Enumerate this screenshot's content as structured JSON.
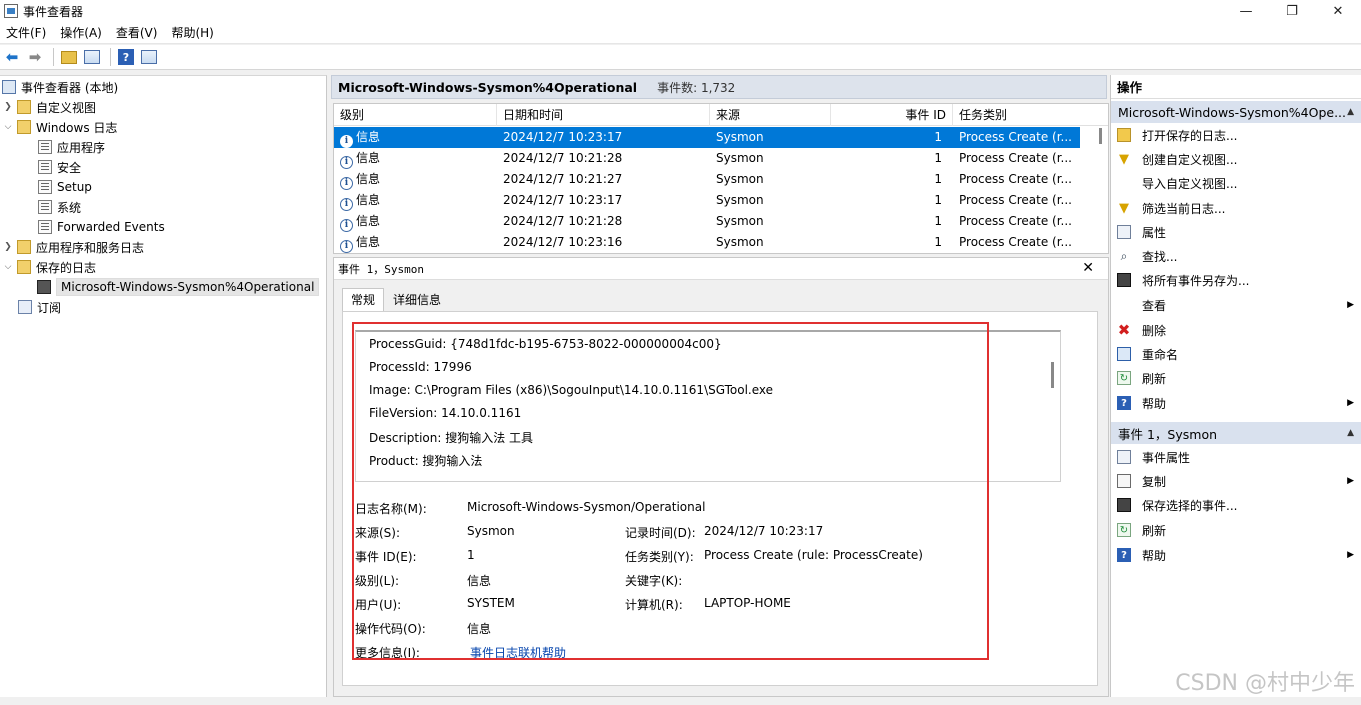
{
  "window": {
    "title": "事件查看器",
    "controls": [
      "—",
      "❐",
      "✕"
    ]
  },
  "menu": [
    "文件(F)",
    "操作(A)",
    "查看(V)",
    "帮助(H)"
  ],
  "tree": {
    "items": [
      {
        "label": "事件查看器 (本地)",
        "icon": "event-viewer-icon"
      },
      {
        "label": "自定义视图",
        "icon": "folder-icon"
      },
      {
        "label": "Windows 日志",
        "icon": "folder-icon"
      },
      {
        "label": "应用程序",
        "icon": "log-icon"
      },
      {
        "label": "安全",
        "icon": "log-icon"
      },
      {
        "label": "Setup",
        "icon": "log-icon"
      },
      {
        "label": "系统",
        "icon": "log-icon"
      },
      {
        "label": "Forwarded Events",
        "icon": "log-icon"
      },
      {
        "label": "应用程序和服务日志",
        "icon": "folder-icon"
      },
      {
        "label": "保存的日志",
        "icon": "folder-icon"
      },
      {
        "label": "Microsoft-Windows-Sysmon%4Operational",
        "icon": "saved-log-icon"
      },
      {
        "label": "订阅",
        "icon": "subscription-icon"
      }
    ]
  },
  "log_header": {
    "name": "Microsoft-Windows-Sysmon%4Operational",
    "count": "事件数: 1,732"
  },
  "grid": {
    "columns": [
      "级别",
      "日期和时间",
      "来源",
      "事件 ID",
      "任务类别"
    ],
    "rows": [
      {
        "level": "信息",
        "datetime": "2024/12/7 10:23:17",
        "source": "Sysmon",
        "id": "1",
        "task": "Process Create (r..."
      },
      {
        "level": "信息",
        "datetime": "2024/12/7 10:21:28",
        "source": "Sysmon",
        "id": "1",
        "task": "Process Create (r..."
      },
      {
        "level": "信息",
        "datetime": "2024/12/7 10:21:27",
        "source": "Sysmon",
        "id": "1",
        "task": "Process Create (r..."
      },
      {
        "level": "信息",
        "datetime": "2024/12/7 10:23:17",
        "source": "Sysmon",
        "id": "1",
        "task": "Process Create (r..."
      },
      {
        "level": "信息",
        "datetime": "2024/12/7 10:21:28",
        "source": "Sysmon",
        "id": "1",
        "task": "Process Create (r..."
      },
      {
        "level": "信息",
        "datetime": "2024/12/7 10:23:16",
        "source": "Sysmon",
        "id": "1",
        "task": "Process Create (r..."
      }
    ]
  },
  "detail": {
    "header": "事件 1，Sysmon",
    "tabs": [
      "常规",
      "详细信息"
    ],
    "xml_lines": [
      "ProcessGuid: {748d1fdc-b195-6753-8022-000000004c00}",
      "ProcessId: 17996",
      "Image: C:\\Program Files (x86)\\SogouInput\\14.10.0.1161\\SGTool.exe",
      "FileVersion: 14.10.0.1161",
      "Description: 搜狗输入法 工具",
      "Product: 搜狗输入法"
    ],
    "fields": {
      "log_name_label": "日志名称(M):",
      "log_name": "Microsoft-Windows-Sysmon/Operational",
      "source_label": "来源(S):",
      "source": "Sysmon",
      "logged_label": "记录时间(D):",
      "logged": "2024/12/7 10:23:17",
      "event_id_label": "事件 ID(E):",
      "event_id": "1",
      "task_label": "任务类别(Y):",
      "task": "Process Create (rule: ProcessCreate)",
      "level_label": "级别(L):",
      "level": "信息",
      "keywords_label": "关键字(K):",
      "user_label": "用户(U):",
      "user": "SYSTEM",
      "computer_label": "计算机(R):",
      "computer": "LAPTOP-HOME",
      "opcode_label": "操作代码(O):",
      "opcode": "信息",
      "more_info_label": "更多信息(I):",
      "more_info_link": "事件日志联机帮助"
    }
  },
  "actions": {
    "title": "操作",
    "section1": "Microsoft-Windows-Sysmon%4Ope...",
    "section1_items": [
      {
        "label": "打开保存的日志...",
        "icon": "open-folder-icon"
      },
      {
        "label": "创建自定义视图...",
        "icon": "filter-icon"
      },
      {
        "label": "导入自定义视图...",
        "icon": ""
      },
      {
        "label": "筛选当前日志...",
        "icon": "filter-icon"
      },
      {
        "label": "属性",
        "icon": "properties-icon"
      },
      {
        "label": "查找...",
        "icon": "find-icon"
      },
      {
        "label": "将所有事件另存为...",
        "icon": "save-icon"
      },
      {
        "label": "查看",
        "icon": "",
        "submenu": true
      },
      {
        "label": "删除",
        "icon": "delete-icon"
      },
      {
        "label": "重命名",
        "icon": "rename-icon"
      },
      {
        "label": "刷新",
        "icon": "refresh-icon"
      },
      {
        "label": "帮助",
        "icon": "help-icon",
        "submenu": true
      }
    ],
    "section2": "事件 1，Sysmon",
    "section2_items": [
      {
        "label": "事件属性",
        "icon": "event-properties-icon"
      },
      {
        "label": "复制",
        "icon": "copy-icon",
        "submenu": true
      },
      {
        "label": "保存选择的事件...",
        "icon": "save-icon"
      },
      {
        "label": "刷新",
        "icon": "refresh-icon"
      },
      {
        "label": "帮助",
        "icon": "help-icon",
        "submenu": true
      }
    ]
  },
  "watermark": "CSDN @村中少年"
}
